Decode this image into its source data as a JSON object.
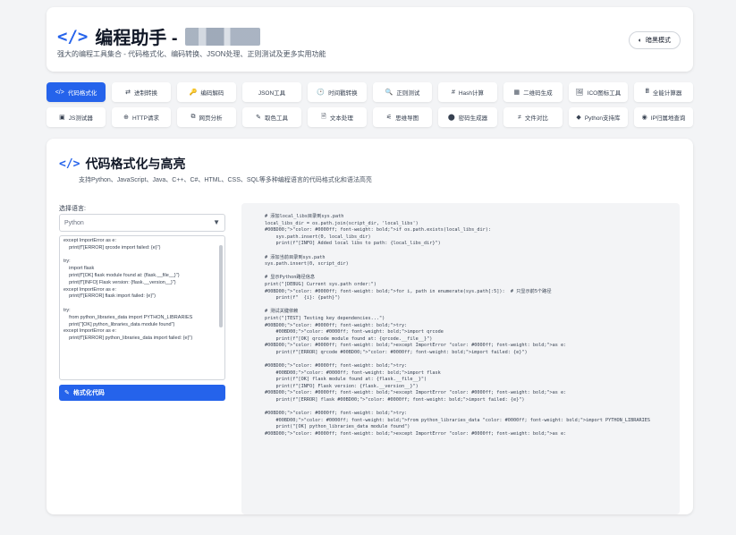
{
  "header": {
    "logo_symbol": "</>",
    "title": "编程助手 -",
    "subtitle": "强大的编程工具集合 - 代码格式化、编码转换、JSON处理、正则测试及更多实用功能",
    "theme_button": "暗黑模式",
    "theme_icon": "half-moon-icon"
  },
  "nav": {
    "row1": [
      {
        "icon": "</>",
        "label": "代码格式化",
        "active": true
      },
      {
        "icon": "⇄",
        "label": "进制转换"
      },
      {
        "icon": "🔑",
        "label": "编码解码"
      },
      {
        "icon": "",
        "label": "JSON工具"
      },
      {
        "icon": "🕑",
        "label": "时间戳转换"
      },
      {
        "icon": "🔍",
        "label": "正则测试"
      },
      {
        "icon": "#",
        "label": "Hash计算"
      },
      {
        "icon": "▦",
        "label": "二维码生成"
      },
      {
        "icon": "🖼",
        "label": "ICO图标工具"
      },
      {
        "icon": "🖩",
        "label": "全能计算器"
      }
    ],
    "row2": [
      {
        "icon": "▣",
        "label": "JS测试器"
      },
      {
        "icon": "⊕",
        "label": "HTTP请求"
      },
      {
        "icon": "⧉",
        "label": "网页分析"
      },
      {
        "icon": "✎",
        "label": "取色工具"
      },
      {
        "icon": "🗎",
        "label": "文本处理"
      },
      {
        "icon": "⚟",
        "label": "思维导图"
      },
      {
        "icon": "⬤",
        "label": "密码生成器"
      },
      {
        "icon": "≠",
        "label": "文件对比"
      },
      {
        "icon": "◆",
        "label": "Python支持库"
      },
      {
        "icon": "◉",
        "label": "IP归属地查询"
      }
    ]
  },
  "section": {
    "icon": "</>",
    "title": "代码格式化与高亮",
    "description": "支持Python、JavaScript、Java、C++、C#、HTML、CSS、SQL等多种编程语言的代码格式化和语法高亮"
  },
  "form": {
    "language_label": "选择语言:",
    "language_value": "Python",
    "caret": "▼",
    "format_button": "格式化代码",
    "format_icon": "✎"
  },
  "input_lines": [
    "except ImportError as e:",
    "    print(f\"[ERROR] qrcode import failed: {e}\")",
    "",
    "try:",
    "    import flask",
    "    print(f\"[OK] flask module found at: {flask.__file__}\")",
    "    print(f\"[INFO] Flask version: {flask.__version__}\")",
    "except ImportError as e:",
    "    print(f\"[ERROR] flask import failed: {e}\")",
    "",
    "try:",
    "    from python_libraries_data import PYTHON_LIBRARIES",
    "    print(\"[OK] python_libraries_data module found\")",
    "except ImportError as e:",
    "    print(f\"[ERROR] python_libraries_data import failed: {e}\")"
  ],
  "output_lines": [
    "# 添加local_libs目录到sys.path",
    "local_libs_dir = os.path.join(script_dir, 'local_libs')",
    "#00BD00;\">\"color: #0000ff; font-weight: bold;\">if os.path.exists(local_libs_dir):",
    "    sys.path.insert(0, local_libs_dir)",
    "    print(f\"[INFO] Added local libs to path: {local_libs_dir}\")",
    "",
    "# 添加当前目录到sys.path",
    "sys.path.insert(0, script_dir)",
    "",
    "# 显示Python路径信息",
    "print(\"[DEBUG] Current sys.path order:\")",
    "#00BD00;\">\"color: #0000ff; font-weight: bold;\">for i, path in enumerate(sys.path[:5]):  # 只显示前5个路径",
    "    print(f\"  {i}: {path}\")",
    "",
    "# 测试关键依赖",
    "print(\"[TEST] Testing key dependencies...\")",
    "#00BD00;\">\"color: #0000ff; font-weight: bold;\">try:",
    "    #00BD00;\">\"color: #0000ff; font-weight: bold;\">import qrcode",
    "    print(f\"[OK] qrcode module found at: {qrcode.__file__}\")",
    "#00BD00;\">\"color: #0000ff; font-weight: bold;\">except ImportError \"color: #0000ff; font-weight: bold;\">as e:",
    "    print(f\"[ERROR] qrcode #00BD00;\">\"color: #0000ff; font-weight: bold;\">import failed: {e}\")",
    "",
    "#00BD00;\">\"color: #0000ff; font-weight: bold;\">try:",
    "    #00BD00;\">\"color: #0000ff; font-weight: bold;\">import flask",
    "    print(f\"[OK] flask module found at: {flask.__file__}\")",
    "    print(f\"[INFO] Flask version: {flask.__version__}\")",
    "#00BD00;\">\"color: #0000ff; font-weight: bold;\">except ImportError \"color: #0000ff; font-weight: bold;\">as e:",
    "    print(f\"[ERROR] flask #00BD00;\">\"color: #0000ff; font-weight: bold;\">import failed: {e}\")",
    "",
    "#00BD00;\">\"color: #0000ff; font-weight: bold;\">try:",
    "    #00BD00;\">\"color: #0000ff; font-weight: bold;\">from python_libraries_data \"color: #0000ff; font-weight: bold;\">import PYTHON_LIBRARIES",
    "    print(\"[OK] python_libraries_data module found\")",
    "#00BD00;\">\"color: #0000ff; font-weight: bold;\">except ImportError \"color: #0000ff; font-weight: bold;\">as e:"
  ],
  "colors": {
    "accent": "#2563eb",
    "background": "#f3f4f6"
  }
}
